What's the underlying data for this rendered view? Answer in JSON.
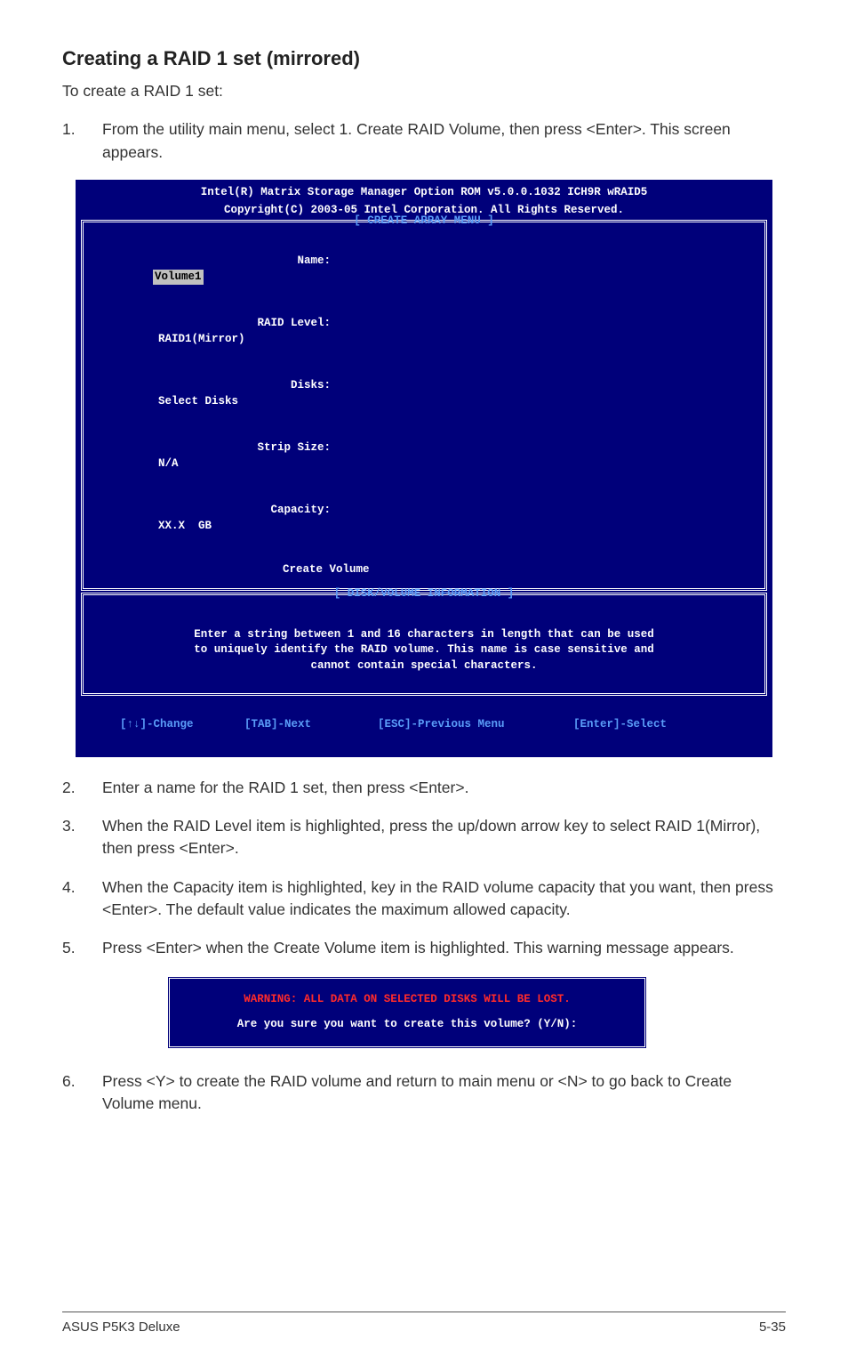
{
  "heading": "Creating a RAID 1 set (mirrored)",
  "intro": "To create a RAID 1 set:",
  "steps": {
    "s1": {
      "num": "1.",
      "text": "From the utility main menu, select 1. Create RAID Volume, then press <Enter>. This screen appears."
    },
    "s2": {
      "num": "2.",
      "text": "Enter a name for the RAID 1 set, then press <Enter>."
    },
    "s3": {
      "num": "3.",
      "text": "When the RAID Level item is highlighted, press the up/down arrow key to select RAID 1(Mirror), then press <Enter>."
    },
    "s4": {
      "num": "4.",
      "text": "When the Capacity item is highlighted, key in the RAID volume capacity that you want, then press <Enter>. The default value indicates the maximum allowed capacity."
    },
    "s5": {
      "num": "5.",
      "text": "Press <Enter> when the Create Volume item is highlighted. This warning message appears."
    },
    "s6": {
      "num": "6.",
      "text": "Press <Y> to create the RAID volume and return to main menu or <N> to go back to Create Volume menu."
    }
  },
  "bios": {
    "header1": "Intel(R) Matrix Storage Manager Option ROM v5.0.0.1032 ICH9R wRAID5",
    "header2": "Copyright(C) 2003-05 Intel Corporation. All Rights Reserved.",
    "section1": "[ CREATE ARRAY MENU ]",
    "rows": {
      "name": {
        "label": "Name:",
        "value": "Volume1"
      },
      "level": {
        "label": "RAID Level:",
        "value": "RAID1(Mirror)"
      },
      "disks": {
        "label": "Disks:",
        "value": "Select Disks"
      },
      "strip": {
        "label": "Strip Size:",
        "value": "N/A"
      },
      "cap": {
        "label": "Capacity:",
        "value": "XX.X  GB"
      }
    },
    "create": "Create Volume",
    "section2": "[ DISK/VOLUME INFORMATION ]",
    "info1": "Enter a string between 1 and 16 characters in length that can be used",
    "info2": "to uniquely identify the RAID volume. This name is case sensitive and",
    "info3": "cannot contain special characters.",
    "footer": {
      "a": "[↑↓]-Change",
      "b": "[TAB]-Next",
      "c": "[ESC]-Previous Menu",
      "d": "[Enter]-Select"
    }
  },
  "warn": {
    "line1": "WARNING: ALL DATA ON SELECTED DISKS WILL BE LOST.",
    "line2": "Are you sure you want to create this volume? (Y/N):"
  },
  "footer": {
    "left": "ASUS P5K3 Deluxe",
    "right": "5-35"
  }
}
